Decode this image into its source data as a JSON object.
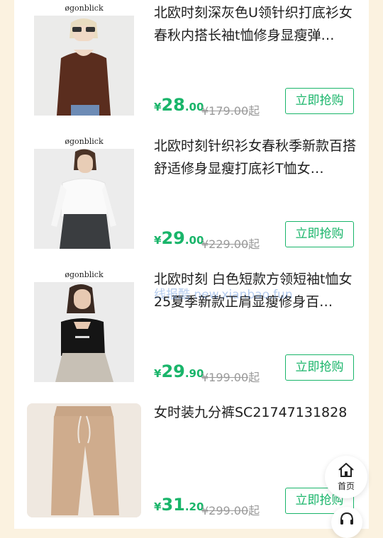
{
  "products": [
    {
      "brand": "øgonblick",
      "title": "北欧时刻深灰色U领针织打底衫女春秋内搭长袖t恤修身显瘦弹…",
      "price_yen": "¥",
      "price_int": "28",
      "price_dec": ".00",
      "orig_price": "¥179.00",
      "orig_suffix": "起",
      "buy_label": "立即抢购"
    },
    {
      "brand": "øgonblick",
      "title": "北欧时刻针织衫女春秋季新款百搭舒适修身显瘦打底衫T恤女…",
      "price_yen": "¥",
      "price_int": "29",
      "price_dec": ".00",
      "orig_price": "¥229.00",
      "orig_suffix": "起",
      "buy_label": "立即抢购"
    },
    {
      "brand": "øgonblick",
      "title": "北欧时刻 白色短款方领短袖t恤女25夏季新款正肩显瘦修身百…",
      "price_yen": "¥",
      "price_int": "29",
      "price_dec": ".90",
      "orig_price": "¥199.00",
      "orig_suffix": "起",
      "buy_label": "立即抢购"
    },
    {
      "brand": "",
      "title": "女时装九分裤SC21747131828",
      "price_yen": "¥",
      "price_int": "31",
      "price_dec": ".20",
      "orig_price": "¥299.00",
      "orig_suffix": "起",
      "buy_label": "立即抢购"
    }
  ],
  "watermark": "线报酷 new.xianbao.fun",
  "fab": {
    "home_label": "首页",
    "home_icon": "home-icon",
    "service_icon": "headset-icon"
  },
  "colors": {
    "accent": "#19b56a",
    "background": "#fbf2e0",
    "strike": "#9a9a9a"
  }
}
